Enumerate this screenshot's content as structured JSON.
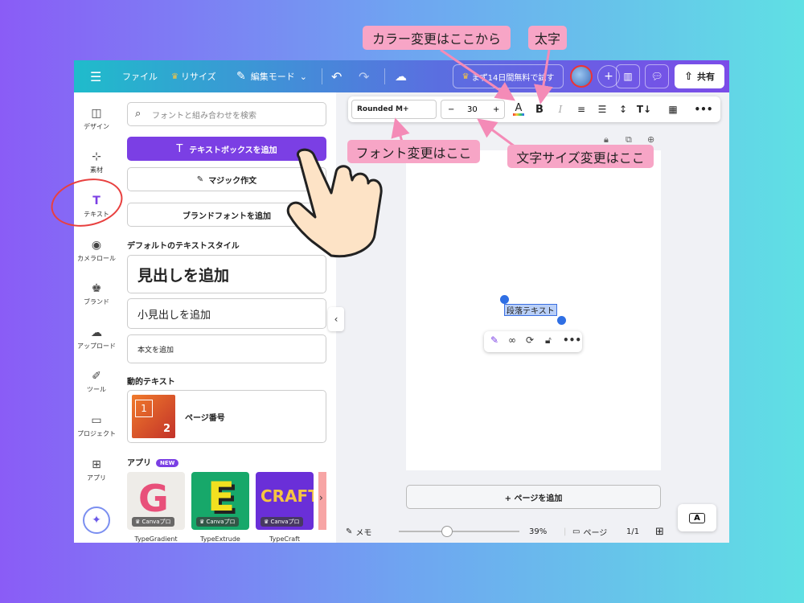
{
  "topbar": {
    "file_label": "ファイル",
    "resize_label": "リサイズ",
    "edit_mode_label": "編集モード",
    "trial_label": "まず14日間無料で試す",
    "share_label": "共有"
  },
  "rail": {
    "items": [
      {
        "label": "デザイン"
      },
      {
        "label": "素材"
      },
      {
        "label": "テキスト"
      },
      {
        "label": "カメラロール"
      },
      {
        "label": "ブランド"
      },
      {
        "label": "アップロード"
      },
      {
        "label": "ツール"
      },
      {
        "label": "プロジェクト"
      },
      {
        "label": "アプリ"
      }
    ]
  },
  "panel": {
    "search_placeholder": "フォントと組み合わせを検索",
    "add_textbox_label": "テキストボックスを追加",
    "magic_write_label": "マジック作文",
    "brand_fonts_label": "ブランドフォントを追加",
    "default_styles_title": "デフォルトのテキストスタイル",
    "heading_label": "見出しを追加",
    "subheading_label": "小見出しを追加",
    "body_label": "本文を追加",
    "dynamic_text_title": "動的テキスト",
    "page_number_label": "ページ番号",
    "page_number_thumb_1": "1",
    "page_number_thumb_2": "2",
    "apps_title": "アプリ",
    "new_badge": "NEW",
    "apps": [
      {
        "name": "TypeGradient",
        "badge": "Canvaプロ"
      },
      {
        "name": "TypeExtrude",
        "badge": "Canvaプロ"
      },
      {
        "name": "TypeCraft",
        "badge": "Canvaプロ"
      }
    ]
  },
  "format_toolbar": {
    "font_name": "Rounded M+",
    "font_size": "30",
    "minus": "−",
    "plus": "+",
    "bold": "B",
    "italic": "I"
  },
  "canvas": {
    "selected_text": "段落テキスト",
    "add_page_label": "+ ページを追加"
  },
  "bottombar": {
    "notes_label": "メモ",
    "zoom_level": "39%",
    "zoom_fraction": 0.39,
    "pages_label": "ページ",
    "page_count": "1/1"
  },
  "annotations": {
    "color_change": "カラー変更はここから",
    "bold": "太字",
    "font_change": "フォント変更はここ",
    "font_size_change": "文字サイズ変更はここ"
  },
  "colors": {
    "accent": "#7b3fe4",
    "callout": "#f7a5c6",
    "highlight_circle": "#e8403f"
  }
}
